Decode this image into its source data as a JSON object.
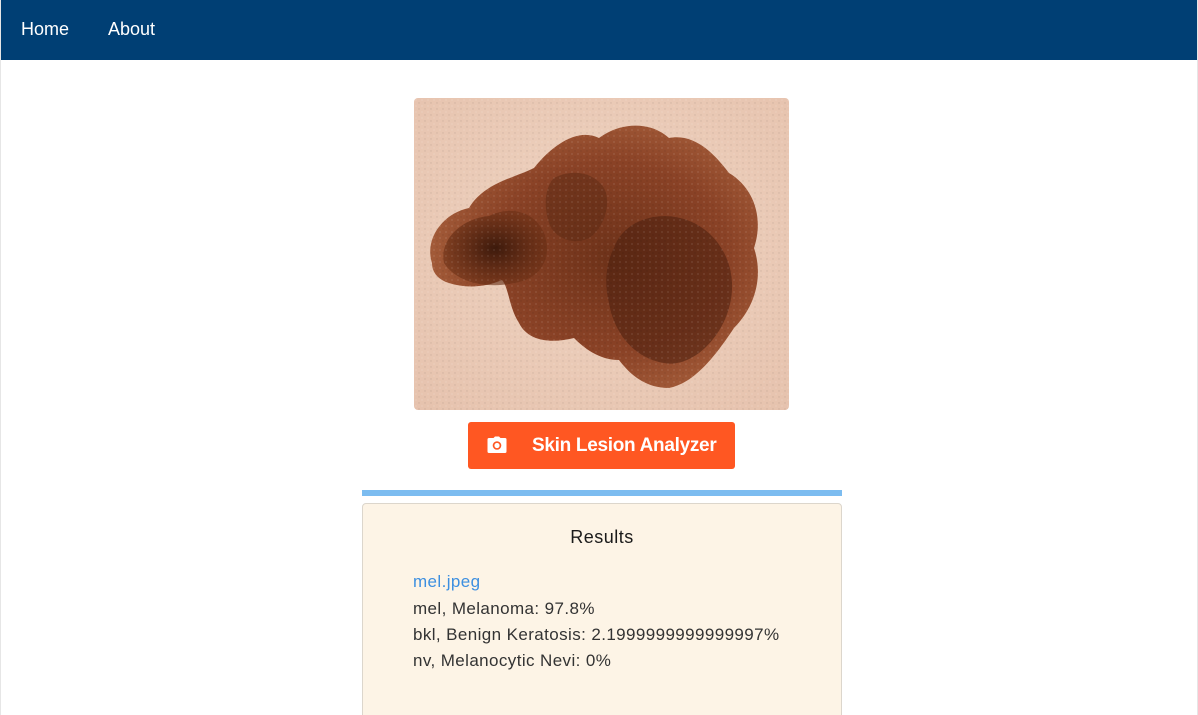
{
  "nav": {
    "home_label": "Home",
    "about_label": "About"
  },
  "image": {
    "alt": "Skin lesion photo"
  },
  "analyzer": {
    "button_label": "Skin Lesion Analyzer",
    "icon": "camera-icon",
    "progress": 1.0
  },
  "results": {
    "title": "Results",
    "file_name": "mel.jpeg",
    "predictions": [
      "mel, Melanoma: 97.8%",
      "bkl, Benign Keratosis: 2.1999999999999997%",
      "nv, Melanocytic Nevi: 0%"
    ]
  },
  "colors": {
    "navbar": "#003f74",
    "button": "#ff5722",
    "progress": "#7cbcf0",
    "card": "#fdf4e6",
    "link": "#3d8fe0"
  }
}
